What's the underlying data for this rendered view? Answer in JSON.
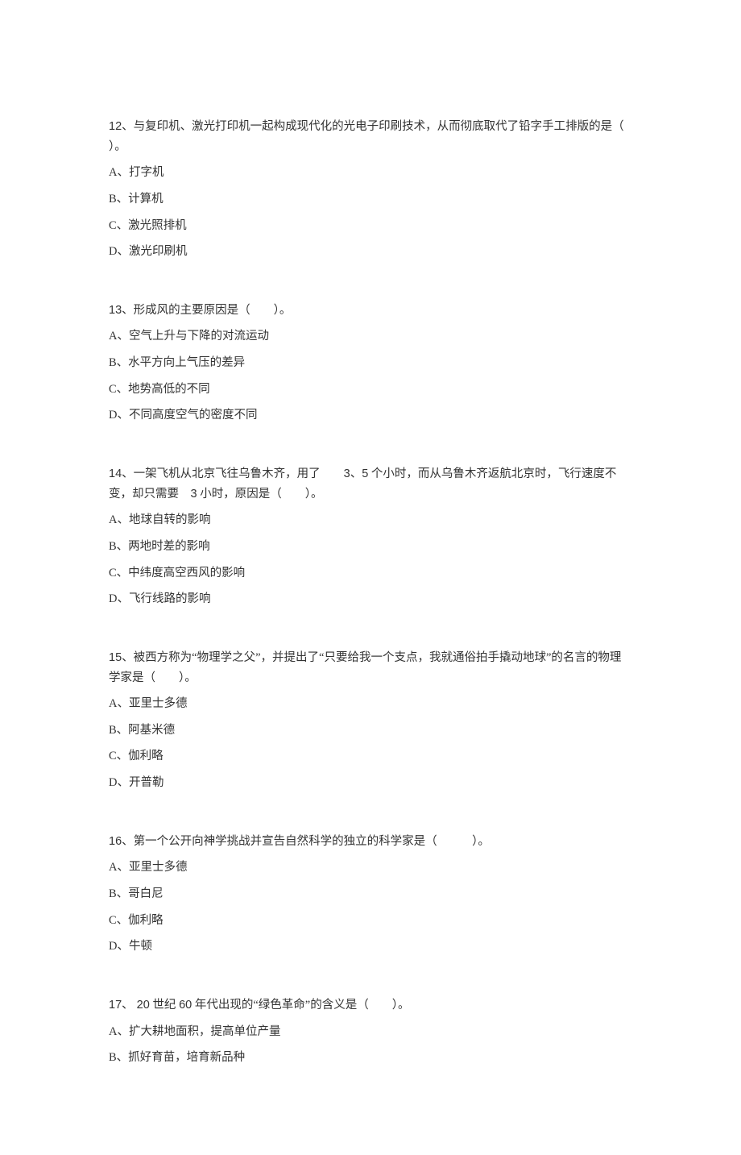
{
  "questions": [
    {
      "number": "12",
      "stem_parts": [
        "与复印机、激光打印机一起构成现代化的光电子印刷技术，从而彻底取代了铅字手工排版的是（ ）。"
      ],
      "options": [
        "A、打字机",
        "B、计算机",
        "C、激光照排机",
        "D、激光印刷机"
      ]
    },
    {
      "number": "13",
      "stem_parts": [
        "形成风的主要原因是（　　）。"
      ],
      "options": [
        "A、空气上升与下降的对流运动",
        "B、水平方向上气压的差异",
        "C、地势高低的不同",
        "D、不同高度空气的密度不同"
      ]
    },
    {
      "number": "14",
      "stem_parts_segments": [
        {
          "t": "、一架飞机从北京飞往乌鲁木齐，用了　　"
        },
        {
          "t": "3",
          "num": true
        },
        {
          "t": "、"
        },
        {
          "t": "5",
          "num": true
        },
        {
          "t": " 个小时，而从乌鲁木齐返航北京时，飞行速度不变，却只需要　"
        },
        {
          "t": "3",
          "num": true
        },
        {
          "t": " 小时，原因是（　　）。"
        }
      ],
      "options": [
        "A、地球自转的影响",
        "B、两地时差的影响",
        "C、中纬度高空西风的影响",
        "D、飞行线路的影响"
      ]
    },
    {
      "number": "15",
      "stem_parts": [
        "被西方称为“物理学之父”，并提出了“只要给我一个支点，我就通俗拍手撬动地球”的名言的物理学家是（　　）。"
      ],
      "options": [
        "A、亚里士多德",
        "B、阿基米德",
        "C、伽利略",
        "D、开普勒"
      ]
    },
    {
      "number": "16",
      "stem_parts": [
        "第一个公开向神学挑战并宣告自然科学的独立的科学家是（　　　）。"
      ],
      "options": [
        "A、亚里士多德",
        "B、哥白尼",
        "C、伽利略",
        "D、牛顿"
      ]
    },
    {
      "number": "17",
      "stem_parts_segments": [
        {
          "t": "、"
        },
        {
          "t": " 20",
          "num": true
        },
        {
          "t": " 世纪 "
        },
        {
          "t": "60",
          "num": true
        },
        {
          "t": " 年代出现的“绿色革命”的含义是（　　）。"
        }
      ],
      "options": [
        "A、扩大耕地面积，提高单位产量",
        "B、抓好育苗，培育新品种"
      ]
    }
  ]
}
